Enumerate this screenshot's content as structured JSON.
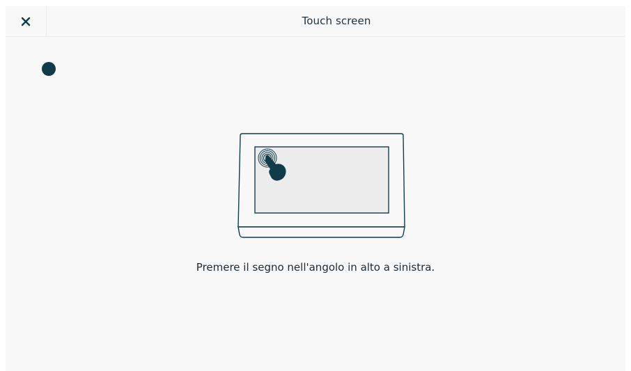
{
  "header": {
    "title": "Touch screen",
    "close_icon": "close-icon"
  },
  "calibration": {
    "target_icon": "calibration-target-dot"
  },
  "illustration": {
    "icon": "touch-device-illustration"
  },
  "instruction_text": "Premere il segno nell'angolo in alto a sinistra.",
  "colors": {
    "accent": "#0f3b4a",
    "background": "#f8f8f8",
    "text": "#22313b"
  }
}
